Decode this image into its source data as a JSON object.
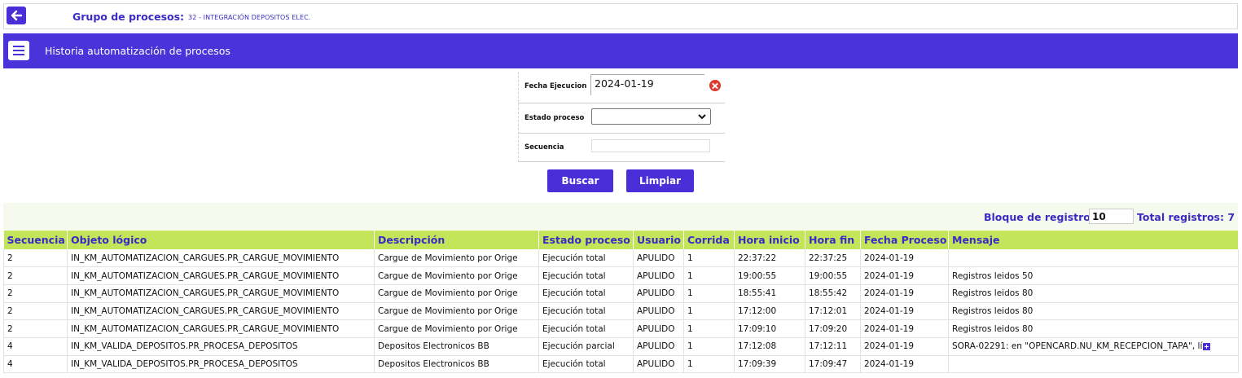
{
  "header": {
    "group_label": "Grupo de procesos:",
    "group_value": "32 - INTEGRACIÓN DEPOSITOS ELEC."
  },
  "title": "Historia automatización de procesos",
  "filters": {
    "fecha_label": "Fecha Ejecucion",
    "fecha_value": "2024-01-19",
    "estado_label": "Estado proceso",
    "estado_value": "",
    "secuencia_label": "Secuencia",
    "secuencia_value": ""
  },
  "buttons": {
    "buscar": "Buscar",
    "limpiar": "Limpiar"
  },
  "records": {
    "bloque_label": "Bloque de registros:",
    "bloque_value": "10",
    "total_label": "Total registros: 7"
  },
  "table": {
    "columns": [
      "Secuencia",
      "Objeto lógico",
      "Descripción",
      "Estado proceso",
      "Usuario",
      "Corrida",
      "Hora inicio",
      "Hora fin",
      "Fecha Proceso",
      "Mensaje"
    ],
    "rows": [
      [
        "2",
        "IN_KM_AUTOMATIZACION_CARGUES.PR_CARGUE_MOVIMIENTO",
        "Cargue de Movimiento por Orige",
        "Ejecución total",
        "APULIDO",
        "1",
        "22:37:22",
        "22:37:25",
        "2024-01-19",
        ""
      ],
      [
        "2",
        "IN_KM_AUTOMATIZACION_CARGUES.PR_CARGUE_MOVIMIENTO",
        "Cargue de Movimiento por Orige",
        "Ejecución total",
        "APULIDO",
        "1",
        "19:00:55",
        "19:00:55",
        "2024-01-19",
        "Registros leidos 50"
      ],
      [
        "2",
        "IN_KM_AUTOMATIZACION_CARGUES.PR_CARGUE_MOVIMIENTO",
        "Cargue de Movimiento por Orige",
        "Ejecución total",
        "APULIDO",
        "1",
        "18:55:41",
        "18:55:42",
        "2024-01-19",
        "Registros leidos 80"
      ],
      [
        "2",
        "IN_KM_AUTOMATIZACION_CARGUES.PR_CARGUE_MOVIMIENTO",
        "Cargue de Movimiento por Orige",
        "Ejecución total",
        "APULIDO",
        "1",
        "17:12:00",
        "17:12:01",
        "2024-01-19",
        "Registros leidos 80"
      ],
      [
        "2",
        "IN_KM_AUTOMATIZACION_CARGUES.PR_CARGUE_MOVIMIENTO",
        "Cargue de Movimiento por Orige",
        "Ejecución total",
        "APULIDO",
        "1",
        "17:09:10",
        "17:09:20",
        "2024-01-19",
        "Registros leidos 80"
      ],
      [
        "4",
        "IN_KM_VALIDA_DEPOSITOS.PR_PROCESA_DEPOSITOS",
        "Depositos Electronicos BB",
        "Ejecución parcial",
        "APULIDO",
        "1",
        "17:12:08",
        "17:12:11",
        "2024-01-19",
        "SORA-02291: en \"OPENCARD.NU_KM_RECEPCION_TAPA\", lí"
      ],
      [
        "4",
        "IN_KM_VALIDA_DEPOSITOS.PR_PROCESA_DEPOSITOS",
        "Depositos Electronicos BB",
        "Ejecución total",
        "APULIDO",
        "1",
        "17:09:39",
        "17:09:47",
        "2024-01-19",
        ""
      ]
    ],
    "expand_row": 5
  },
  "colors": {
    "accent": "#4a2fd8",
    "header_bg": "#c3e55a",
    "link_text": "#3a2bc4"
  }
}
